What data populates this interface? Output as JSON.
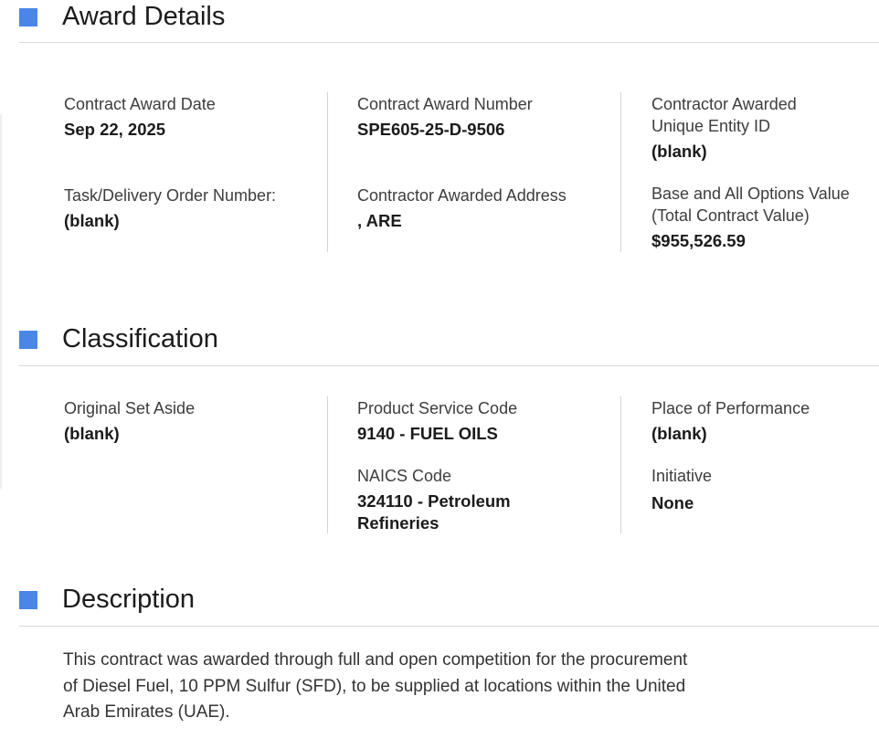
{
  "award_details": {
    "title": "Award Details",
    "contract_award_date": {
      "label": "Contract Award Date",
      "value": "Sep 22, 2025"
    },
    "contract_award_number": {
      "label": "Contract Award Number",
      "value": "SPE605-25-D-9506"
    },
    "contractor_uei": {
      "label_line1": "Contractor Awarded",
      "label_line2": "Unique Entity ID",
      "value": "(blank)"
    },
    "task_order_number": {
      "label": "Task/Delivery Order Number:",
      "value": "(blank)"
    },
    "contractor_address": {
      "label": "Contractor Awarded Address",
      "value": ", ARE"
    },
    "total_value": {
      "label_line1": "Base and All Options Value",
      "label_line2": "(Total Contract Value)",
      "value": "$955,526.59"
    }
  },
  "classification": {
    "title": "Classification",
    "original_set_aside": {
      "label": "Original Set Aside",
      "value": "(blank)"
    },
    "product_service_code": {
      "label": "Product Service Code",
      "value": "9140 - FUEL OILS"
    },
    "naics_code": {
      "label": "NAICS Code",
      "value_line1": "324110 - Petroleum",
      "value_line2": "Refineries"
    },
    "place_of_performance": {
      "label": "Place of Performance",
      "value": "(blank)"
    },
    "initiative": {
      "label": "Initiative",
      "value": "None"
    }
  },
  "description": {
    "title": "Description",
    "line1": "This contract was awarded through full and open competition for the procurement",
    "line2": "of Diesel Fuel, 10 PPM Sulfur (SFD), to be supplied at locations within the United",
    "line3": "Arab Emirates (UAE)."
  },
  "colors": {
    "accent": "#4a86e8",
    "rule": "#d9d9d9",
    "text": "#1b1b1b",
    "label": "#3d3d3d"
  }
}
